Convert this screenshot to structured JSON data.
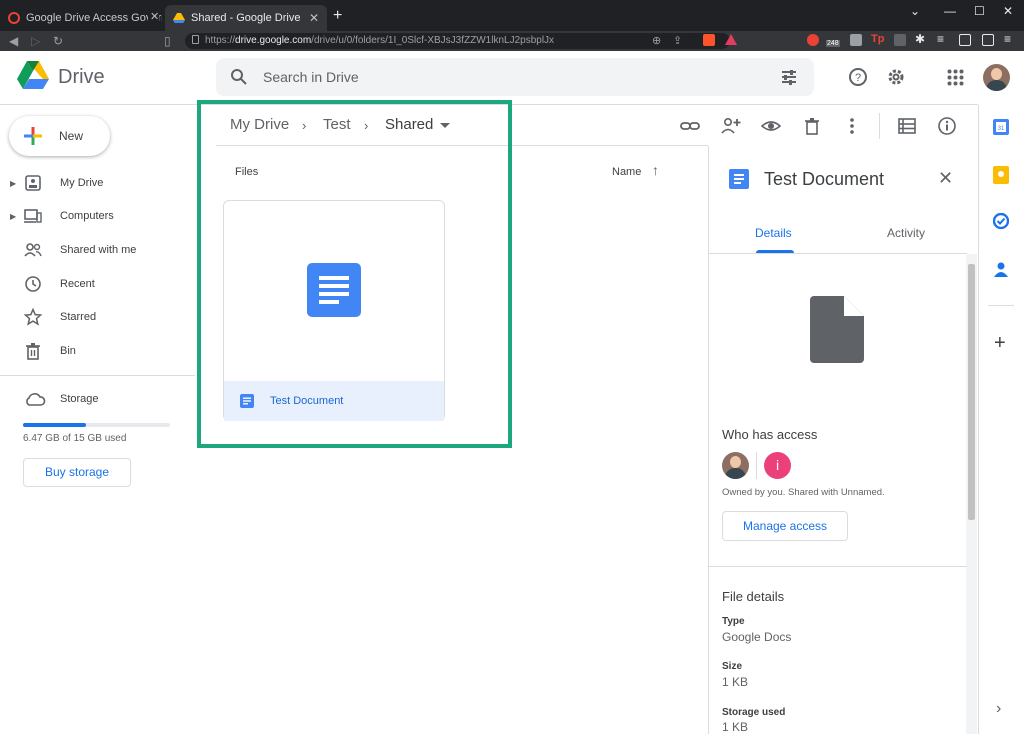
{
  "browser": {
    "tabs": [
      {
        "title": "Google Drive Access Governance Dom",
        "active": false
      },
      {
        "title": "Shared - Google Drive",
        "active": true
      }
    ],
    "new_tab": "+",
    "url_prefix": "https://",
    "url_host": "drive.google.com",
    "url_path": "/drive/u/0/folders/1I_0Slcf-XBJsJ3fZZW1lknLJ2psbplJx",
    "ext_badge": "248",
    "ext_tp": "Tp"
  },
  "app": {
    "logo_text": "Drive",
    "search_placeholder": "Search in Drive"
  },
  "sidebar": {
    "new_label": "New",
    "items": [
      {
        "label": "My Drive",
        "icon": "my-drive-icon"
      },
      {
        "label": "Computers",
        "icon": "computers-icon"
      },
      {
        "label": "Shared with me",
        "icon": "shared-icon"
      },
      {
        "label": "Recent",
        "icon": "clock-icon"
      },
      {
        "label": "Starred",
        "icon": "star-icon"
      },
      {
        "label": "Bin",
        "icon": "bin-icon"
      }
    ],
    "storage_label": "Storage",
    "storage_used_text": "6.47 GB of 15 GB used",
    "storage_fraction": 0.43,
    "buy_storage": "Buy storage"
  },
  "breadcrumb": [
    "My Drive",
    "Test",
    "Shared"
  ],
  "files": {
    "section_label": "Files",
    "sort_label": "Name",
    "items": [
      {
        "name": "Test Document"
      }
    ]
  },
  "details": {
    "title": "Test Document",
    "tab_details": "Details",
    "tab_activity": "Activity",
    "who_has_access": "Who has access",
    "avatar_letter": "i",
    "owned_text": "Owned by you. Shared with Unnamed.",
    "manage_access": "Manage access",
    "file_details": "File details",
    "fields": [
      {
        "label": "Type",
        "value": "Google Docs"
      },
      {
        "label": "Size",
        "value": "1 KB"
      },
      {
        "label": "Storage used",
        "value": "1 KB"
      }
    ]
  },
  "colors": {
    "accent_blue": "#1a73e8",
    "highlight_green": "#1da77f",
    "docs_blue": "#4285f4"
  }
}
